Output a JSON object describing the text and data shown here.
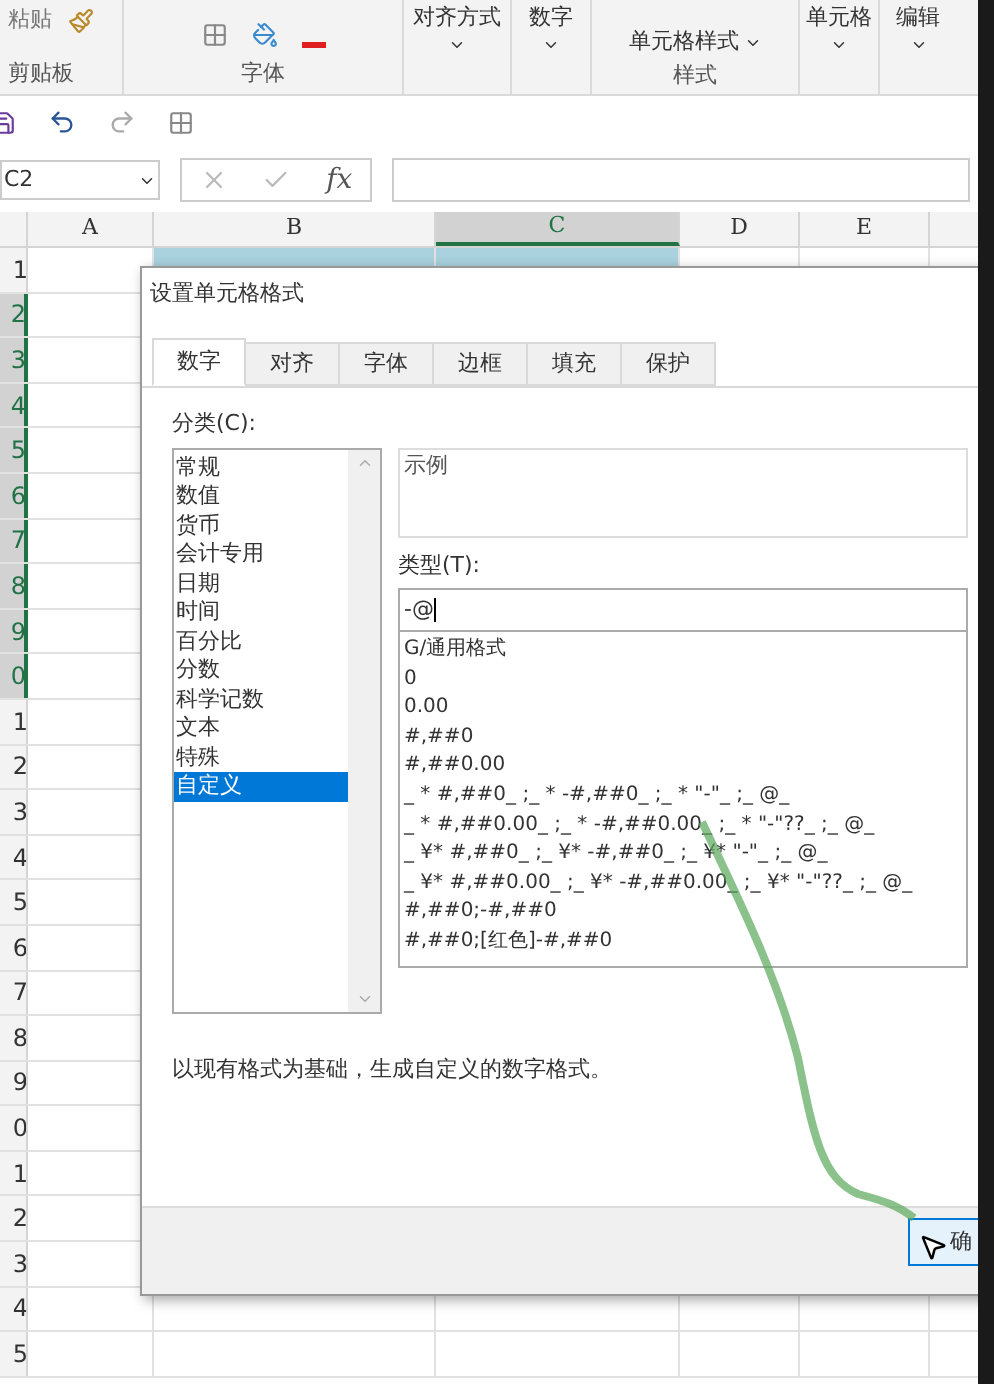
{
  "ribbon": {
    "paste": "粘贴",
    "alignment": "对齐方式",
    "number": "数字",
    "cell_styles": "单元格样式",
    "cells": "单元格",
    "editing": "编辑",
    "group_labels": [
      "剪贴板",
      "字体",
      "样式"
    ]
  },
  "name_box": "C2",
  "formula_button": "fx",
  "columns": [
    {
      "label": "A",
      "selected": false
    },
    {
      "label": "B",
      "selected": false
    },
    {
      "label": "C",
      "selected": true
    },
    {
      "label": "D",
      "selected": false
    },
    {
      "label": "E",
      "selected": false
    }
  ],
  "rows": [
    {
      "label": "1",
      "selected": false
    },
    {
      "label": "2",
      "selected": true
    },
    {
      "label": "3",
      "selected": true
    },
    {
      "label": "4",
      "selected": true
    },
    {
      "label": "5",
      "selected": true
    },
    {
      "label": "6",
      "selected": true
    },
    {
      "label": "7",
      "selected": true
    },
    {
      "label": "8",
      "selected": true
    },
    {
      "label": "9",
      "selected": true
    },
    {
      "label": "0",
      "selected": true
    },
    {
      "label": "1",
      "selected": false
    },
    {
      "label": "2",
      "selected": false
    },
    {
      "label": "3",
      "selected": false
    },
    {
      "label": "4",
      "selected": false
    },
    {
      "label": "5",
      "selected": false
    },
    {
      "label": "6",
      "selected": false
    },
    {
      "label": "7",
      "selected": false
    },
    {
      "label": "8",
      "selected": false
    },
    {
      "label": "9",
      "selected": false
    },
    {
      "label": "0",
      "selected": false
    },
    {
      "label": "1",
      "selected": false
    },
    {
      "label": "2",
      "selected": false
    },
    {
      "label": "3",
      "selected": false
    },
    {
      "label": "4",
      "selected": false
    },
    {
      "label": "5",
      "selected": false
    }
  ],
  "dialog": {
    "title": "设置单元格格式",
    "tabs": [
      {
        "label": "数字",
        "selected": true
      },
      {
        "label": "对齐",
        "selected": false
      },
      {
        "label": "字体",
        "selected": false
      },
      {
        "label": "边框",
        "selected": false
      },
      {
        "label": "填充",
        "selected": false
      },
      {
        "label": "保护",
        "selected": false
      }
    ],
    "category_label": "分类(C):",
    "categories": [
      {
        "label": "常规",
        "selected": false
      },
      {
        "label": "数值",
        "selected": false
      },
      {
        "label": "货币",
        "selected": false
      },
      {
        "label": "会计专用",
        "selected": false
      },
      {
        "label": "日期",
        "selected": false
      },
      {
        "label": "时间",
        "selected": false
      },
      {
        "label": "百分比",
        "selected": false
      },
      {
        "label": "分数",
        "selected": false
      },
      {
        "label": "科学记数",
        "selected": false
      },
      {
        "label": "文本",
        "selected": false
      },
      {
        "label": "特殊",
        "selected": false
      },
      {
        "label": "自定义",
        "selected": true
      }
    ],
    "sample_label": "示例",
    "type_label": "类型(T):",
    "type_value": "-@",
    "formats": [
      "G/通用格式",
      "0",
      "0.00",
      "#,##0",
      "#,##0.00",
      "_ * #,##0_ ;_ * -#,##0_ ;_ * \"-\"_ ;_ @_",
      "_ * #,##0.00_ ;_ * -#,##0.00_ ;_ * \"-\"??_ ;_ @_",
      "_ ¥* #,##0_ ;_ ¥* -#,##0_ ;_ ¥* \"-\"_ ;_ @_",
      "_ ¥* #,##0.00_ ;_ ¥* -#,##0.00_ ;_ ¥* \"-\"??_ ;_ @_",
      "#,##0;-#,##0",
      "#,##0;[红色]-#,##0"
    ],
    "description": "以现有格式为基础，生成自定义的数字格式。",
    "ok_button": "确"
  }
}
